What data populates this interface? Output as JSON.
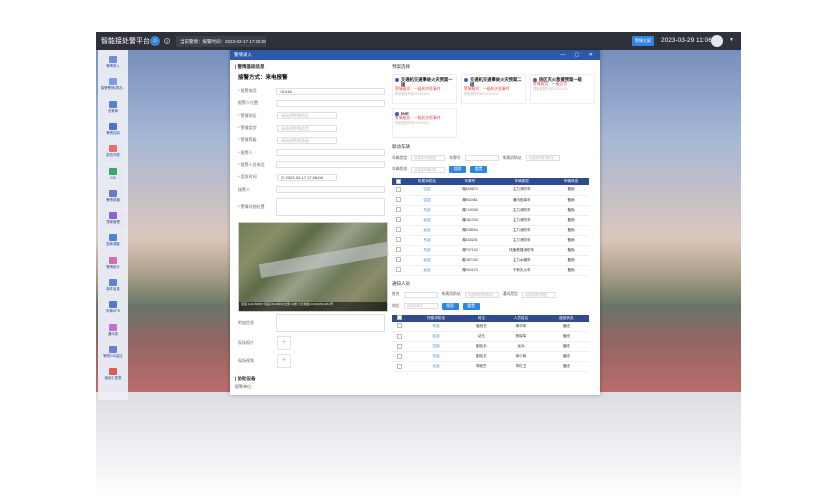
{
  "app": {
    "brand": "智能接处警平台",
    "alarm_bar": "当前警情：报警时间：2023-02-17 17:28:08",
    "top_button": "警情大屏",
    "datetime": "2023-03-29 11:06"
  },
  "sidebar": [
    {
      "label": "警情录入",
      "color": "#6d8fd8"
    },
    {
      "label": "接警警情(再次...",
      "color": "#7a9ee0"
    },
    {
      "label": "出警单",
      "color": "#5c7fd1"
    },
    {
      "label": "警情控制",
      "color": "#4f73c9"
    },
    {
      "label": "报告列表",
      "color": "#e86c6c"
    },
    {
      "label": "GIS",
      "color": "#3aa86b"
    },
    {
      "label": "警情录播",
      "color": "#6a79c8"
    },
    {
      "label": "预案管理",
      "color": "#8a64d0"
    },
    {
      "label": "指挥调度",
      "color": "#5083d6"
    },
    {
      "label": "警情统计",
      "color": "#d26cb5"
    },
    {
      "label": "事件信息",
      "color": "#5f84d4"
    },
    {
      "label": "车辆GPS",
      "color": "#4f7ad0"
    },
    {
      "label": "通讯录",
      "color": "#c770d0"
    },
    {
      "label": "警情GIS监控",
      "color": "#6c7fd8"
    },
    {
      "label": "值班汇报表",
      "color": "#e05a5a"
    }
  ],
  "modal": {
    "title": "警情录入",
    "controls": "—  ▢  ✕",
    "left": {
      "section_title": "| 警情基础信息",
      "report_type": "接警方式：来电报警",
      "fields": [
        {
          "label": "报警电话",
          "value": "01418",
          "required": true,
          "placeholder": false,
          "type": "wide"
        },
        {
          "label": "报警人位置",
          "value": "",
          "required": false,
          "placeholder": false,
          "type": "wide"
        },
        {
          "label": "警情地区",
          "value": "请选择警情地区",
          "required": true,
          "placeholder": true,
          "type": "mid"
        },
        {
          "label": "警情类型",
          "value": "请选择警情类型",
          "required": true,
          "placeholder": true,
          "type": "mid"
        },
        {
          "label": "警情等级",
          "value": "请选择警情等级",
          "required": true,
          "placeholder": true,
          "type": "mid"
        },
        {
          "label": "报警人",
          "value": "",
          "required": true,
          "placeholder": false,
          "type": "wide"
        },
        {
          "label": "报警人员电话",
          "value": "",
          "required": true,
          "placeholder": false,
          "type": "wide"
        },
        {
          "label": "案发时间",
          "value": "◷ 2023-02-17 17:28:08",
          "required": true,
          "placeholder": false,
          "type": "mid"
        },
        {
          "label": "接警人",
          "value": "",
          "required": false,
          "placeholder": false,
          "type": "wide"
        },
        {
          "label": "警情详细位置",
          "value": "",
          "required": true,
          "placeholder": false,
          "type": "tall"
        }
      ],
      "map_footer": "经度:1112.80607  纬度:36.60939  比例 30米  ©天地图 GS(2023)1061号",
      "attach_label": "附加信息",
      "photo_label": "现场照片",
      "video_label": "现场视频",
      "upload_plus": "+",
      "section2_title": "| 协助设备",
      "section2_sub": "报警单位："
    },
    "right": {
      "plan_title": "预案选择",
      "plans": [
        {
          "title": "交通机交通事故火灾预案一级",
          "level": "警情级别：一级机关惩事件",
          "note": "预案更新时间2023/05/11"
        },
        {
          "title": "交通机交通事故火灾预案二级",
          "level": "警情级别：一级机关惩事件",
          "note": "预案更新时间2023/05/11"
        },
        {
          "title": "扬区灭火救援预案一级",
          "level": "警情级别：一级火灾",
          "note": "预案更新时间2023/05/11"
        },
        {
          "title": "test",
          "level": "警情级别：一级机关惩事件",
          "note": "预案更新时间2023/05/11"
        }
      ],
      "vehicle_title": "联动车辆",
      "vehicle_filter": {
        "l1": "车辆类型",
        "l2": "车牌号",
        "l3": "所属消防站",
        "p1": "请选择车辆类型",
        "p3": "请选择所属消防站",
        "l4": "车辆状态",
        "p4": "请选择车辆状态",
        "search": "搜索",
        "reset": "重置"
      },
      "vehicle_headers": [
        "所属消防站",
        "车牌号",
        "车辆类型",
        "车辆状态"
      ],
      "vehicles": [
        [
          "空站",
          "湘A05672",
          "主力消防车",
          "备勤"
        ],
        [
          "空站",
          "湘B02461",
          "通讯指挥车",
          "备勤"
        ],
        [
          "东站",
          "湘C19205",
          "主力消防车",
          "备勤"
        ],
        [
          "北站",
          "湘D61234",
          "主力消防车",
          "备勤"
        ],
        [
          "北站",
          "湘E28094",
          "主力消防车",
          "备勤"
        ],
        [
          "东站",
          "湘A33201",
          "主力消防车",
          "备勤"
        ],
        [
          "东站",
          "湘F07102",
          "快速救援消防车",
          "备勤"
        ],
        [
          "北站",
          "湘G87102",
          "主力水罐车",
          "备勤"
        ],
        [
          "北站",
          "湘H01123",
          "干粉灭火车",
          "备勤"
        ]
      ],
      "people_title": "通知人员",
      "people_filter": {
        "l1": "姓名",
        "l2": "所属消防站",
        "p2": "请选择所属消防站",
        "l3": "通讯类型",
        "p3": "请选择通讯类型",
        "l4": "岗位",
        "p4": "请选择岗位",
        "search": "搜索",
        "reset": "重置"
      },
      "people_headers": [
        "所属消防站",
        "岗位",
        "人员姓名",
        "值班状态"
      ],
      "people": [
        [
          "东站",
          "值班长",
          "蒋华军",
          "值班"
        ],
        [
          "北站",
          "站长",
          "蔡晓军",
          "值班"
        ],
        [
          "空站",
          "副站长",
          "龙兵",
          "值班"
        ],
        [
          "东站",
          "副站长",
          "徐小辉",
          "值班"
        ],
        [
          "北站",
          "驾驶员",
          "李红卫",
          "值班"
        ]
      ]
    }
  }
}
